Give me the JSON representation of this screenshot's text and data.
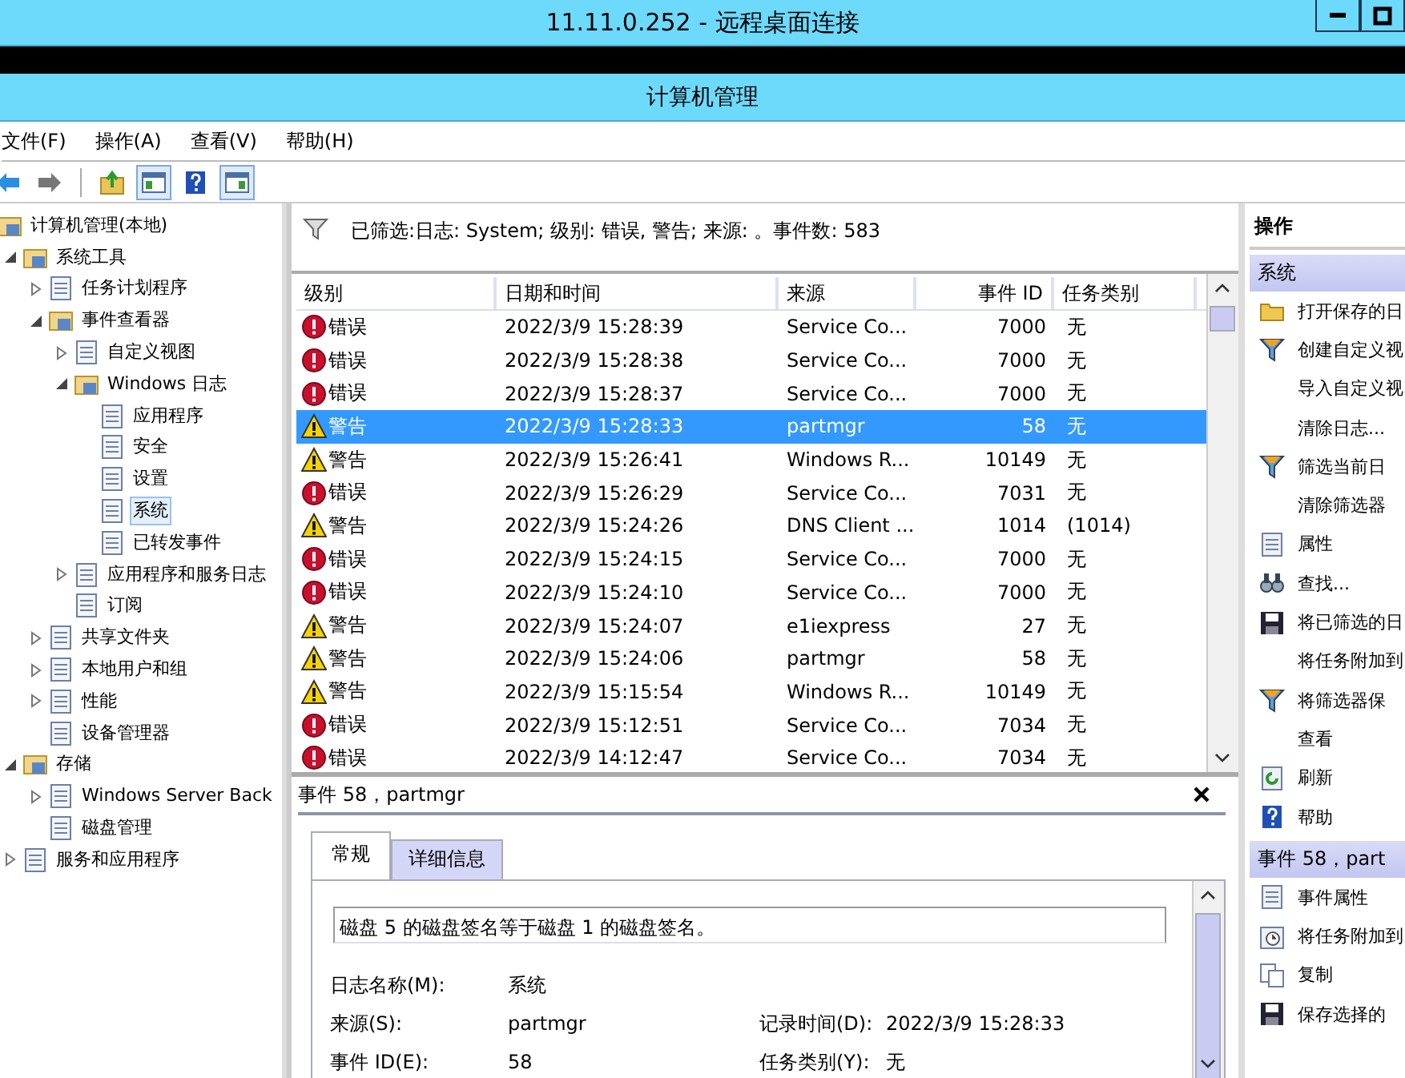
{
  "rdp_window": {
    "title": "11.11.0.252 - 远程桌面连接"
  },
  "window": {
    "title": "计算机管理"
  },
  "menu": [
    "文件(F)",
    "操作(A)",
    "查看(V)",
    "帮助(H)"
  ],
  "tree": [
    {
      "label": "计算机管理(本地)",
      "selected": false,
      "children": [
        {
          "label": "系统工具",
          "selected": false,
          "expanded": true,
          "children": [
            {
              "label": "任务计划程序",
              "selected": false,
              "expanded": false
            },
            {
              "label": "事件查看器",
              "selected": false,
              "expanded": true,
              "children": [
                {
                  "label": "自定义视图",
                  "selected": false,
                  "expanded": false
                },
                {
                  "label": "Windows 日志",
                  "selected": false,
                  "expanded": true,
                  "children": [
                    {
                      "label": "应用程序",
                      "selected": false
                    },
                    {
                      "label": "安全",
                      "selected": false
                    },
                    {
                      "label": "设置",
                      "selected": false
                    },
                    {
                      "label": "系统",
                      "selected": true
                    },
                    {
                      "label": "已转发事件",
                      "selected": false
                    }
                  ]
                },
                {
                  "label": "应用程序和服务日志",
                  "selected": false,
                  "expanded": false
                },
                {
                  "label": "订阅",
                  "selected": false
                }
              ]
            },
            {
              "label": "共享文件夹",
              "selected": false,
              "expanded": false
            },
            {
              "label": "本地用户和组",
              "selected": false,
              "expanded": false
            },
            {
              "label": "性能",
              "selected": false,
              "expanded": false
            },
            {
              "label": "设备管理器",
              "selected": false
            }
          ]
        },
        {
          "label": "存储",
          "selected": false,
          "expanded": true,
          "children": [
            {
              "label": "Windows Server Back",
              "selected": false,
              "expanded": false
            },
            {
              "label": "磁盘管理",
              "selected": false
            }
          ]
        },
        {
          "label": "服务和应用程序",
          "selected": false,
          "expanded": false
        }
      ]
    }
  ],
  "filter": {
    "text": "已筛选:日志: System; 级别: 错误, 警告; 来源: 。事件数: 583"
  },
  "table": {
    "columns": [
      "级别",
      "日期和时间",
      "来源",
      "事件 ID",
      "任务类别"
    ],
    "rows": [
      {
        "kind": "error",
        "level": "错误",
        "date": "2022/3/9 15:28:39",
        "source": "Service Co...",
        "event_id": "7000",
        "category": "无",
        "selected": false
      },
      {
        "kind": "error",
        "level": "错误",
        "date": "2022/3/9 15:28:38",
        "source": "Service Co...",
        "event_id": "7000",
        "category": "无",
        "selected": false
      },
      {
        "kind": "error",
        "level": "错误",
        "date": "2022/3/9 15:28:37",
        "source": "Service Co...",
        "event_id": "7000",
        "category": "无",
        "selected": false
      },
      {
        "kind": "warning",
        "level": "警告",
        "date": "2022/3/9 15:28:33",
        "source": "partmgr",
        "event_id": "58",
        "category": "无",
        "selected": true
      },
      {
        "kind": "warning",
        "level": "警告",
        "date": "2022/3/9 15:26:41",
        "source": "Windows R...",
        "event_id": "10149",
        "category": "无",
        "selected": false
      },
      {
        "kind": "error",
        "level": "错误",
        "date": "2022/3/9 15:26:29",
        "source": "Service Co...",
        "event_id": "7031",
        "category": "无",
        "selected": false
      },
      {
        "kind": "warning",
        "level": "警告",
        "date": "2022/3/9 15:24:26",
        "source": "DNS Client ...",
        "event_id": "1014",
        "category": "(1014)",
        "selected": false
      },
      {
        "kind": "error",
        "level": "错误",
        "date": "2022/3/9 15:24:15",
        "source": "Service Co...",
        "event_id": "7000",
        "category": "无",
        "selected": false
      },
      {
        "kind": "error",
        "level": "错误",
        "date": "2022/3/9 15:24:10",
        "source": "Service Co...",
        "event_id": "7000",
        "category": "无",
        "selected": false
      },
      {
        "kind": "warning",
        "level": "警告",
        "date": "2022/3/9 15:24:07",
        "source": "e1iexpress",
        "event_id": "27",
        "category": "无",
        "selected": false
      },
      {
        "kind": "warning",
        "level": "警告",
        "date": "2022/3/9 15:24:06",
        "source": "partmgr",
        "event_id": "58",
        "category": "无",
        "selected": false
      },
      {
        "kind": "warning",
        "level": "警告",
        "date": "2022/3/9 15:15:54",
        "source": "Windows R...",
        "event_id": "10149",
        "category": "无",
        "selected": false
      },
      {
        "kind": "error",
        "level": "错误",
        "date": "2022/3/9 15:12:51",
        "source": "Service Co...",
        "event_id": "7034",
        "category": "无",
        "selected": false
      },
      {
        "kind": "error",
        "level": "错误",
        "date": "2022/3/9 14:12:47",
        "source": "Service Co...",
        "event_id": "7034",
        "category": "无",
        "selected": false
      }
    ]
  },
  "details": {
    "title": "事件 58，partmgr",
    "tabs": [
      {
        "label": "常规",
        "selected": true
      },
      {
        "label": "详细信息",
        "selected": false
      }
    ],
    "message": "磁盘 5 的磁盘签名等于磁盘 1 的磁盘签名。",
    "fields": [
      [
        {
          "label": "日志名称(M):",
          "value": "系统"
        }
      ],
      [
        {
          "label": "来源(S):",
          "value": "partmgr"
        },
        {
          "label": "记录时间(D):",
          "value": "2022/3/9 15:28:33"
        }
      ],
      [
        {
          "label": "事件 ID(E):",
          "value": "58"
        },
        {
          "label": "任务类别(Y):",
          "value": "无"
        }
      ]
    ]
  },
  "actions": {
    "title": "操作",
    "sections": [
      {
        "title": "系统",
        "items": [
          {
            "kind": "folder",
            "label": "打开保存的日"
          },
          {
            "kind": "filter",
            "label": "创建自定义视"
          },
          {
            "kind": "plain",
            "label": "导入自定义视"
          },
          {
            "kind": "plain",
            "label": "清除日志..."
          },
          {
            "kind": "filter",
            "label": "筛选当前日"
          },
          {
            "kind": "plain",
            "label": "清除筛选器"
          },
          {
            "kind": "page",
            "label": "属性"
          },
          {
            "kind": "find",
            "label": "查找..."
          },
          {
            "kind": "save",
            "label": "将已筛选的日"
          },
          {
            "kind": "plain",
            "label": "将任务附加到"
          },
          {
            "kind": "filter",
            "label": "将筛选器保"
          },
          {
            "kind": "plain",
            "label": "查看"
          },
          {
            "kind": "refresh",
            "label": "刷新"
          },
          {
            "kind": "help",
            "label": "帮助"
          }
        ]
      },
      {
        "title": "事件 58，part",
        "items": [
          {
            "kind": "page",
            "label": "事件属性"
          },
          {
            "kind": "clock",
            "label": "将任务附加到"
          },
          {
            "kind": "copy",
            "label": "复制"
          },
          {
            "kind": "save",
            "label": "保存选择的"
          }
        ]
      }
    ]
  }
}
